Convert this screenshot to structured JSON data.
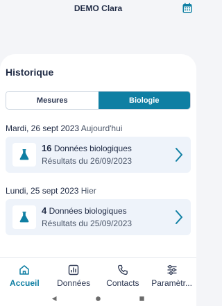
{
  "header": {
    "title": "DEMO Clara",
    "calendar_icon": "calendar-icon"
  },
  "history": {
    "title": "Historique",
    "tabs": [
      {
        "label": "Mesures",
        "selected": false
      },
      {
        "label": "Biologie",
        "selected": true
      }
    ],
    "entries": [
      {
        "date": "Mardi, 26 sept 2023",
        "relative": "Aujourd'hui",
        "count": "16",
        "label": "Données biologiques",
        "subtitle": "Résultats du 26/09/2023",
        "icon": "flask-icon"
      },
      {
        "date": "Lundi, 25 sept 2023",
        "relative": "Hier",
        "count": "4",
        "label": "Données biologiques",
        "subtitle": "Résultats du 25/09/2023",
        "icon": "flask-icon"
      }
    ]
  },
  "bottom_nav": {
    "items": [
      {
        "label": "Accueil",
        "icon": "home-icon",
        "active": true
      },
      {
        "label": "Données",
        "icon": "chart-icon",
        "active": false
      },
      {
        "label": "Contacts",
        "icon": "phone-icon",
        "active": false
      },
      {
        "label": "Paramètr...",
        "icon": "sliders-icon",
        "active": false
      }
    ]
  },
  "system_nav": {
    "icons": [
      "back-icon",
      "home-dot-icon",
      "recents-icon"
    ]
  },
  "colors": {
    "accent": "#0f7fa3",
    "text": "#1f2a44",
    "card_bg": "#eef3fa",
    "background": "#f4f5f8"
  }
}
